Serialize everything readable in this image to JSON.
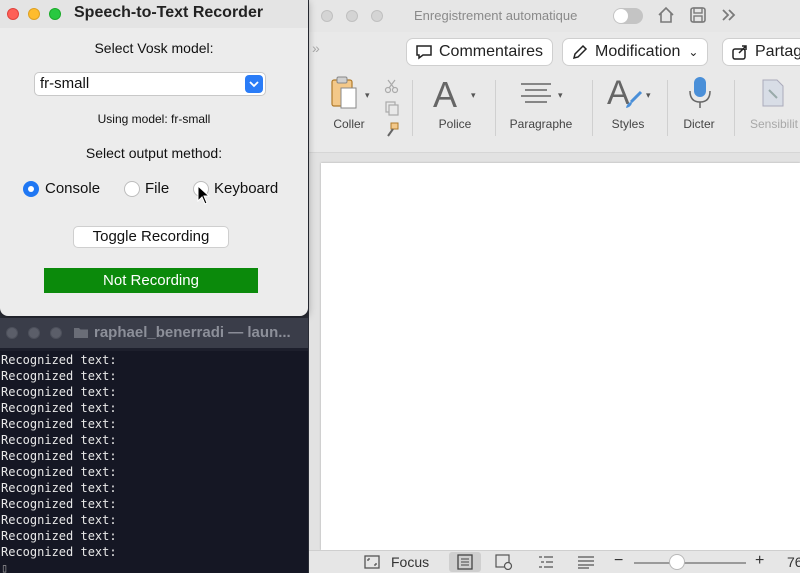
{
  "recorder": {
    "title": "Speech-to-Text Recorder",
    "model_prompt": "Select Vosk model:",
    "model_selected": "fr-small",
    "model_status": "Using model: fr-small",
    "output_prompt": "Select output method:",
    "output_options": [
      {
        "label": "Console",
        "selected": true
      },
      {
        "label": "File",
        "selected": false
      },
      {
        "label": "Keyboard",
        "selected": false
      }
    ],
    "toggle_label": "Toggle Recording",
    "status_label": "Not Recording",
    "status_color": "#0b8a0b"
  },
  "terminal": {
    "title": "raphael_benerradi — laun...",
    "lines": [
      "Recognized text:",
      "Recognized text:",
      "Recognized text:",
      "Recognized text:",
      "Recognized text:",
      "Recognized text:",
      "Recognized text:",
      "Recognized text:",
      "Recognized text:",
      "Recognized text:",
      "Recognized text:",
      "Recognized text:",
      "Recognized text:"
    ]
  },
  "word": {
    "autosave_label": "Enregistrement automatique",
    "autosave_on": false,
    "comments_label": "Commentaires",
    "mode_label": "Modification",
    "share_label": "Partag",
    "ribbon": {
      "paste": "Coller",
      "font": "Police",
      "paragraph": "Paragraphe",
      "styles": "Styles",
      "dictate": "Dicter",
      "sensitivity": "Sensibilit"
    },
    "status": {
      "focus": "Focus",
      "zoom_partial": "76"
    }
  },
  "colors": {
    "accent_blue": "#1f77f3",
    "recording_off_green": "#0b8a0b"
  }
}
